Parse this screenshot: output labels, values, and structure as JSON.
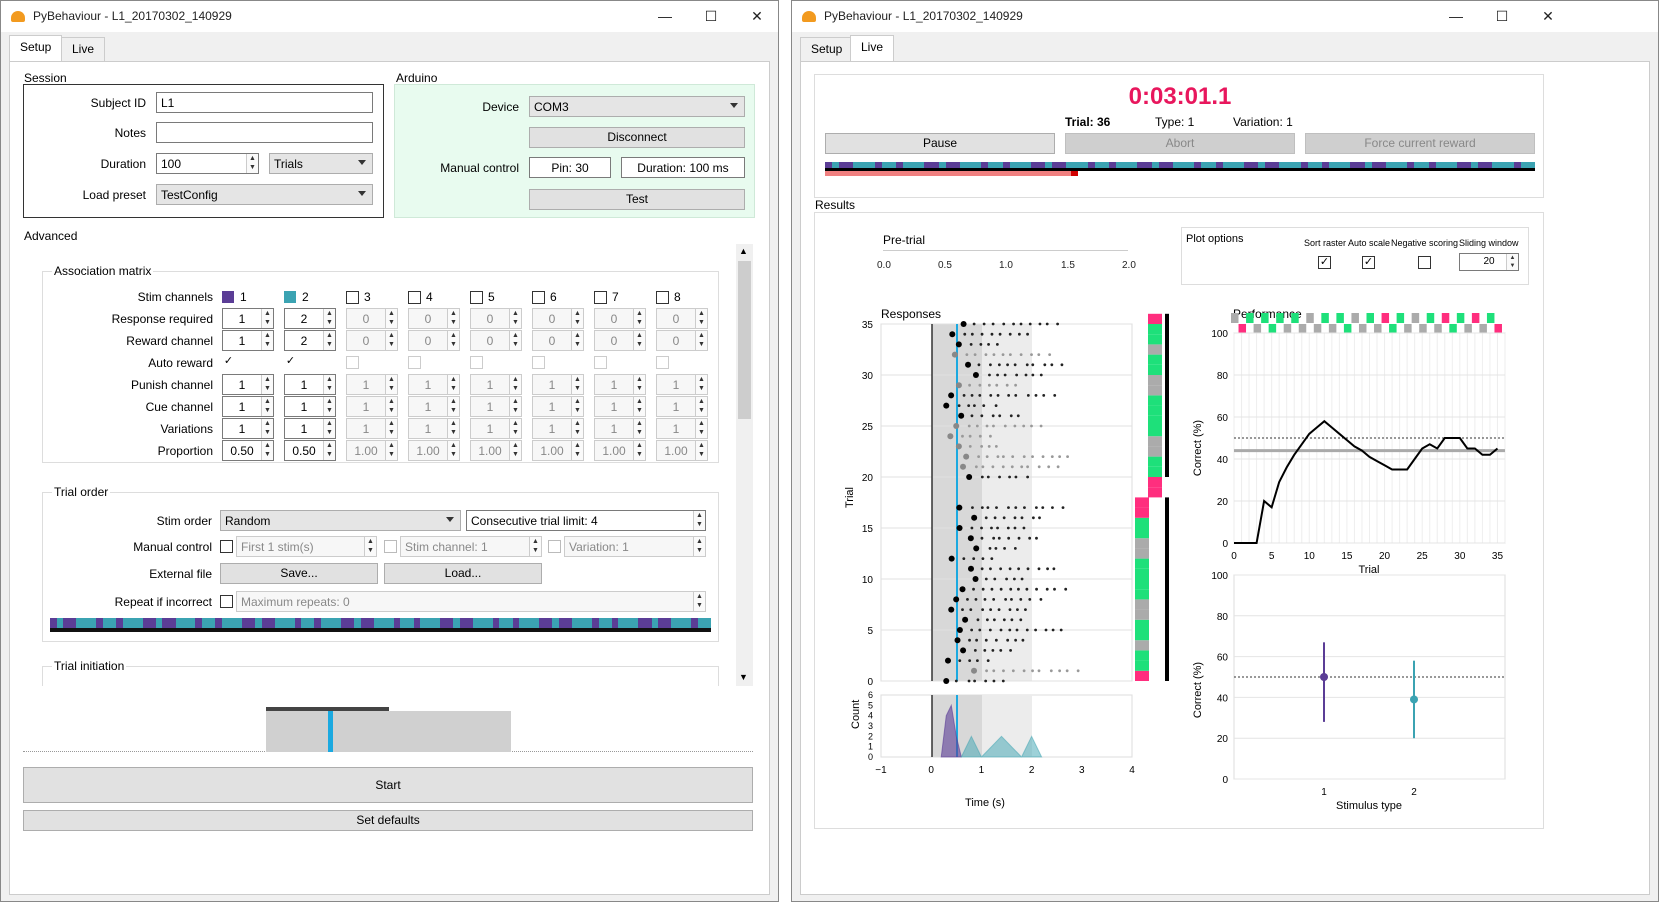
{
  "windows": {
    "left": {
      "title": "PyBehaviour - L1_20170302_140929",
      "tabs": [
        "Setup",
        "Live"
      ],
      "active_tab": "Setup"
    },
    "right": {
      "title": "PyBehaviour - L1_20170302_140929",
      "tabs": [
        "Setup",
        "Live"
      ],
      "active_tab": "Live"
    }
  },
  "controls": {
    "minimize": "—",
    "maximize": "☐",
    "close": "✕"
  },
  "session": {
    "heading": "Session",
    "subject_label": "Subject ID",
    "subject_value": "L1",
    "notes_label": "Notes",
    "notes_value": "",
    "duration_label": "Duration",
    "duration_value": "100",
    "duration_unit": "Trials",
    "preset_label": "Load preset",
    "preset_value": "TestConfig"
  },
  "arduino": {
    "heading": "Arduino",
    "device_label": "Device",
    "device_value": "COM3",
    "disconnect": "Disconnect",
    "manual_label": "Manual control",
    "pin": "Pin: 30",
    "duration": "Duration: 100 ms",
    "test": "Test",
    "bg_color": "#e8fbef"
  },
  "advanced": {
    "heading": "Advanced"
  },
  "association": {
    "heading": "Association matrix",
    "row_labels": [
      "Stim channels",
      "Response required",
      "Reward channel",
      "Auto reward",
      "Punish channel",
      "Cue channel",
      "Variations",
      "Proportion"
    ],
    "channels": [
      "1",
      "2",
      "3",
      "4",
      "5",
      "6",
      "7",
      "8"
    ],
    "response_required": [
      "1",
      "2",
      "0",
      "0",
      "0",
      "0",
      "0",
      "0"
    ],
    "reward_channel": [
      "1",
      "2",
      "0",
      "0",
      "0",
      "0",
      "0",
      "0"
    ],
    "punish_channel": [
      "1",
      "1",
      "1",
      "1",
      "1",
      "1",
      "1",
      "1"
    ],
    "cue_channel": [
      "1",
      "1",
      "1",
      "1",
      "1",
      "1",
      "1",
      "1"
    ],
    "variations": [
      "1",
      "1",
      "1",
      "1",
      "1",
      "1",
      "1",
      "1"
    ],
    "proportion": [
      "0.50",
      "0.50",
      "1.00",
      "1.00",
      "1.00",
      "1.00",
      "1.00",
      "1.00"
    ],
    "stim_colors": [
      "#5b3d96",
      "#3ba3b2"
    ]
  },
  "trial_order": {
    "heading": "Trial order",
    "stim_order_label": "Stim order",
    "stim_order_value": "Random",
    "consecutive_limit": "Consecutive trial limit: 4",
    "manual_label": "Manual control",
    "manual_first": "First 1 stim(s)",
    "manual_stim": "Stim channel: 1",
    "manual_variation": "Variation: 1",
    "external_label": "External file",
    "save": "Save...",
    "load": "Load...",
    "repeat_label": "Repeat if incorrect",
    "repeat_value": "Maximum repeats: 0"
  },
  "trial_initiation": {
    "heading": "Trial initiation"
  },
  "buttons": {
    "start": "Start",
    "set_defaults": "Set defaults"
  },
  "live": {
    "timer": "0:03:01.1",
    "trial": "Trial: 36",
    "type": "Type:  1",
    "variation": "Variation:  1",
    "pause": "Pause",
    "abort": "Abort",
    "force_reward": "Force current reward",
    "timer_color": "#e8175d",
    "results_heading": "Results",
    "pretrial_label": "Pre-trial",
    "pretrial_ticks": [
      "0.0",
      "0.5",
      "1.0",
      "1.5",
      "2.0"
    ],
    "plot_options": {
      "heading": "Plot options",
      "sort_raster": "Sort raster",
      "auto_scale": "Auto scale",
      "negative_scoring": "Negative scoring",
      "sliding_window": "Sliding window",
      "sliding_value": "20"
    }
  },
  "responses_plot": {
    "title": "Responses",
    "ylabel": "Trial",
    "yticks": [
      "0",
      "5",
      "10",
      "15",
      "20",
      "25",
      "30",
      "35"
    ],
    "count_label": "Count",
    "count_ticks": [
      "0",
      "1",
      "2",
      "3",
      "4",
      "5",
      "6"
    ],
    "xlabel": "Time (s)",
    "xticks": [
      "−1",
      "0",
      "1",
      "2",
      "3",
      "4"
    ]
  },
  "performance_plot": {
    "title": "Performance",
    "ylabel": "Correct (%)",
    "xlabel": "Trial",
    "yticks": [
      "0",
      "20",
      "40",
      "60",
      "80",
      "100"
    ],
    "xticks": [
      "0",
      "5",
      "10",
      "15",
      "20",
      "25",
      "30",
      "35"
    ]
  },
  "stim_plot": {
    "ylabel": "Correct (%)",
    "xlabel": "Stimulus type",
    "yticks": [
      "0",
      "20",
      "40",
      "60",
      "80",
      "100"
    ],
    "xticks": [
      "1",
      "2"
    ]
  },
  "chart_data": [
    {
      "type": "line",
      "title": "Performance",
      "xlabel": "Trial",
      "ylabel": "Correct (%)",
      "x": [
        0,
        1,
        2,
        3,
        4,
        5,
        6,
        7,
        8,
        9,
        10,
        11,
        12,
        13,
        14,
        15,
        16,
        17,
        18,
        19,
        20,
        21,
        22,
        23,
        24,
        25,
        26,
        27,
        28,
        29,
        30,
        31,
        32,
        33,
        34,
        35
      ],
      "series": [
        {
          "values": [
            0,
            0,
            0,
            0,
            20,
            17,
            29,
            36,
            42,
            47,
            52,
            55,
            58,
            55,
            52,
            49,
            46,
            44,
            41,
            39,
            37,
            35,
            35,
            35,
            40,
            45,
            47,
            45,
            50,
            50,
            50,
            45,
            45,
            42,
            42,
            45
          ]
        }
      ],
      "reference_line": 50,
      "xlim": [
        0,
        36
      ],
      "ylim": [
        0,
        100
      ]
    },
    {
      "type": "scatter",
      "xlabel": "Stimulus type",
      "ylabel": "Correct (%)",
      "categories": [
        "1",
        "2"
      ],
      "values": [
        50,
        39
      ],
      "error_low": [
        28,
        20
      ],
      "error_high": [
        67,
        58
      ],
      "reference_line": 50,
      "ylim": [
        0,
        100
      ]
    },
    {
      "type": "area",
      "xlabel": "Time (s)",
      "ylabel": "Count",
      "xlim": [
        -1,
        4
      ],
      "ylim": [
        0,
        6
      ],
      "series": [
        {
          "x": [
            0.2,
            0.3,
            0.4,
            0.5,
            0.6
          ],
          "values": [
            0,
            4,
            5,
            2,
            0
          ]
        },
        {
          "x": [
            0.6,
            0.8,
            1.0,
            1.2,
            1.4,
            1.6,
            1.8,
            2.0,
            2.2
          ],
          "values": [
            0,
            2,
            0,
            1,
            2,
            1,
            0,
            2,
            0
          ]
        }
      ]
    }
  ]
}
